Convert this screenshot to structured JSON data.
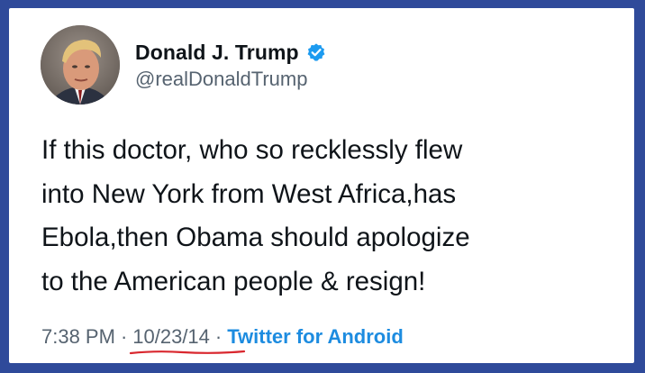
{
  "tweet": {
    "display_name": "Donald J. Trump",
    "handle": "@realDonaldTrump",
    "verified": true,
    "text_lines": [
      "If this doctor, who so recklessly flew",
      "into New York from West Africa,has",
      "Ebola,then Obama should apologize",
      "to the American people & resign!"
    ],
    "time": "7:38 PM",
    "separator": "·",
    "date": "10/23/14",
    "source": "Twitter for Android"
  },
  "colors": {
    "border": "#2f4a9a",
    "card": "#ffffff",
    "text": "#0f1419",
    "secondary": "#566370",
    "link": "#1d8ce0",
    "verified_badge": "#1d9bf0",
    "date_underline": "#d9272e"
  },
  "icons": {
    "verified": "verified-badge-icon",
    "avatar": "profile-photo"
  }
}
